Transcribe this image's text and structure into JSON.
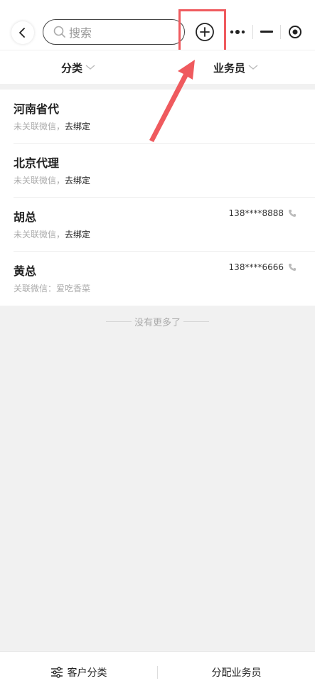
{
  "header": {
    "search_placeholder": "搜索"
  },
  "filters": {
    "category": "分类",
    "salesperson": "业务员"
  },
  "customers": [
    {
      "name": "河南省代",
      "status": "未关联微信，",
      "action": "去绑定",
      "phone": ""
    },
    {
      "name": "北京代理",
      "status": "未关联微信，",
      "action": "去绑定",
      "phone": ""
    },
    {
      "name": "胡总",
      "status": "未关联微信，",
      "action": "去绑定",
      "phone": "138****8888"
    },
    {
      "name": "黄总",
      "status": "关联微信：爱吃香菜",
      "action": "",
      "phone": "138****6666"
    }
  ],
  "footer_note": "没有更多了",
  "bottom": {
    "category_button": "客户分类",
    "assign_button": "分配业务员"
  },
  "colors": {
    "highlight": "#ef5a5e"
  }
}
